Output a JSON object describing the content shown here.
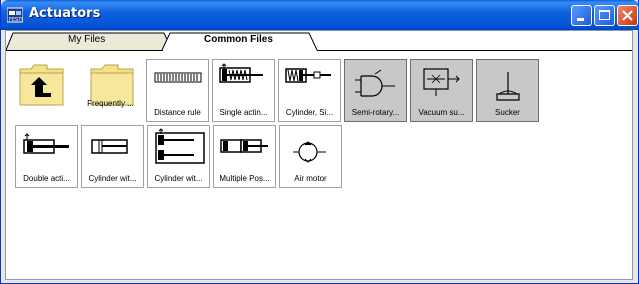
{
  "window": {
    "title": "Actuators"
  },
  "tabs": [
    {
      "label": "My Files",
      "active": false
    },
    {
      "label": "Common Files",
      "active": true
    }
  ],
  "items_row1": [
    {
      "label": "",
      "icon": "folder-up-icon",
      "selected": false
    },
    {
      "label": "Frequently ...",
      "icon": "folder-icon",
      "selected": false
    },
    {
      "label": "Distance rule",
      "icon": "distance-rule-icon",
      "selected": false
    },
    {
      "label": "Single actin...",
      "icon": "single-acting-cylinder-icon",
      "selected": false
    },
    {
      "label": "Cylinder, Si...",
      "icon": "cylinder-spring-icon",
      "selected": false
    },
    {
      "label": "Semi-rotary...",
      "icon": "semi-rotary-icon",
      "selected": true
    },
    {
      "label": "Vacuum su...",
      "icon": "vacuum-suction-icon",
      "selected": true
    },
    {
      "label": "Sucker",
      "icon": "sucker-icon",
      "selected": true
    }
  ],
  "items_row2": [
    {
      "label": "Double acti...",
      "icon": "double-acting-cylinder-icon"
    },
    {
      "label": "Cylinder wit...",
      "icon": "cylinder-with-icon"
    },
    {
      "label": "Cylinder wit...",
      "icon": "cylinder-with-multi-icon"
    },
    {
      "label": "Multiple Pos...",
      "icon": "multiple-position-cylinder-icon"
    },
    {
      "label": "Air motor",
      "icon": "air-motor-icon"
    }
  ]
}
